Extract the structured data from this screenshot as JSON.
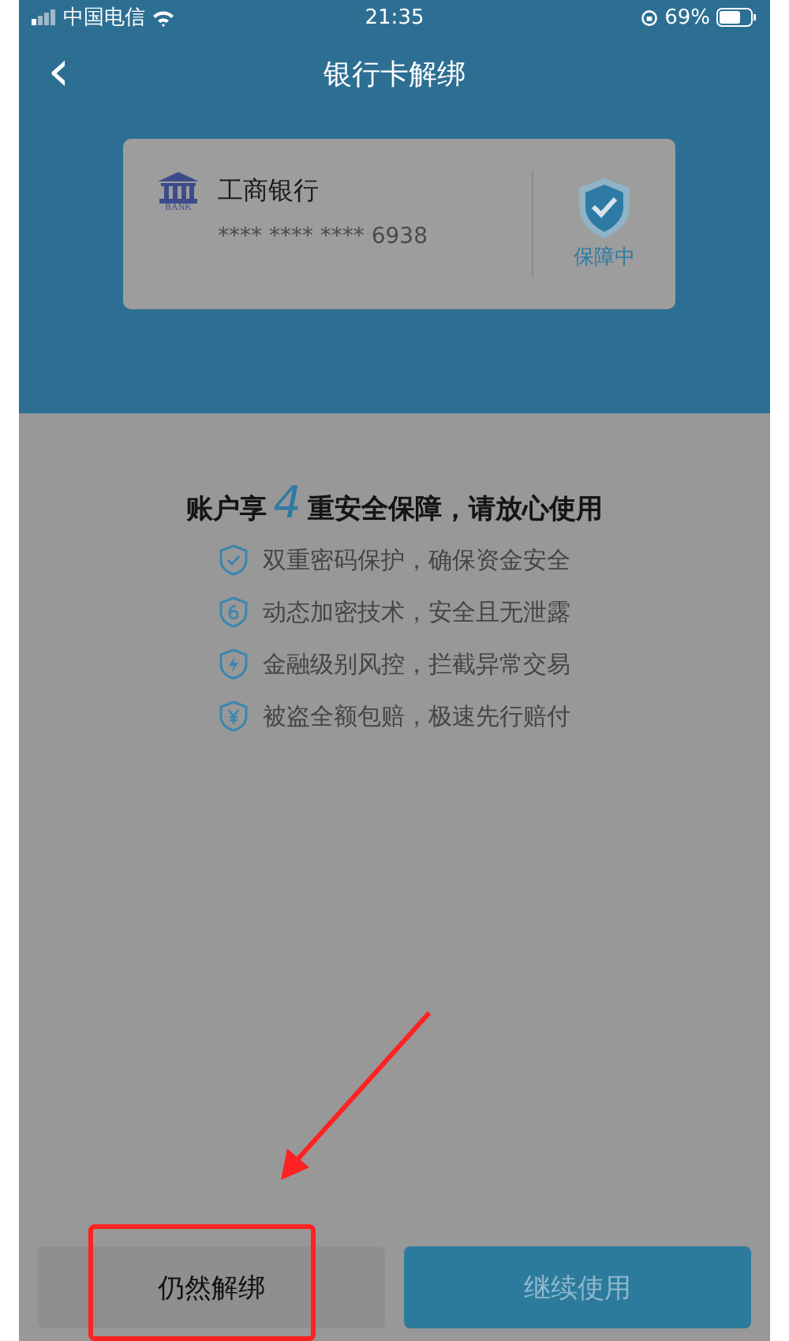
{
  "status_bar": {
    "carrier": "中国电信",
    "time": "21:35",
    "battery": "69%"
  },
  "nav": {
    "back": "‹",
    "title": "银行卡解绑"
  },
  "card": {
    "logo_text": "BANK",
    "bank_name": "工商银行",
    "card_number": "**** **** **** 6938",
    "status": "保障中"
  },
  "headline": {
    "prefix": "账户享",
    "number": "4",
    "suffix": "重安全保障，请放心使用"
  },
  "features": [
    {
      "kind": "check",
      "text": "双重密码保护，确保资金安全"
    },
    {
      "kind": "digit",
      "text": "动态加密技术，安全且无泄露"
    },
    {
      "kind": "bolt",
      "text": "金融级别风控，拦截异常交易"
    },
    {
      "kind": "yen",
      "text": "被盗全额包赔，极速先行赔付"
    }
  ],
  "buttons": [
    {
      "kind": "secondary",
      "label": "仍然解绑"
    },
    {
      "kind": "primary",
      "label": "继续使用"
    }
  ]
}
